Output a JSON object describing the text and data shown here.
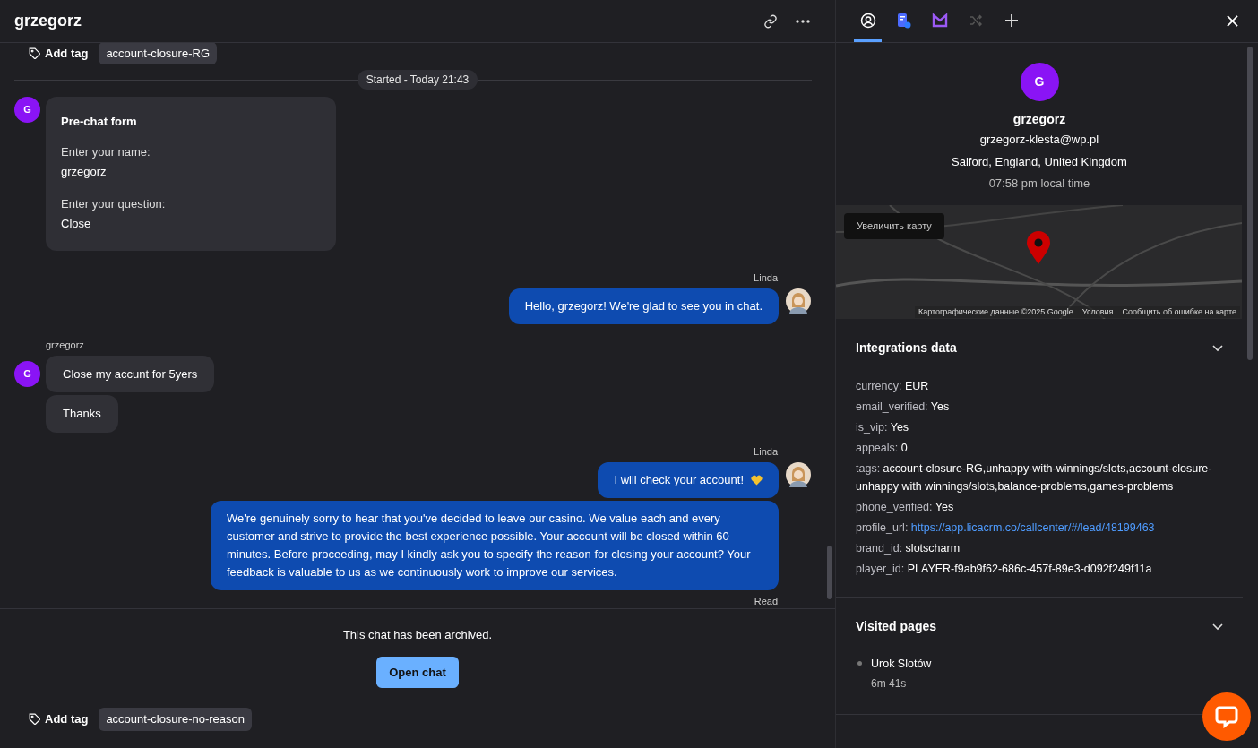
{
  "chat": {
    "title": "grzegorz",
    "top_tags": {
      "add_label": "Add tag",
      "tags": [
        "account-closure-RG"
      ]
    },
    "divider": "Started - Today 21:43",
    "messages": [
      {
        "kind": "form",
        "avatar": "G",
        "title": "Pre-chat form",
        "fields": [
          {
            "label": "Enter your name:",
            "value": "grzegorz"
          },
          {
            "label": "Enter your question:",
            "value": "Close"
          }
        ]
      },
      {
        "kind": "agent",
        "author": "Linda",
        "bubbles": [
          {
            "text": "Hello, grzegorz! We're glad to see you in chat.",
            "heart": false
          }
        ]
      },
      {
        "kind": "customer",
        "author": "grzegorz",
        "avatar": "G",
        "bubbles": [
          {
            "text": "Close my accunt for 5yers"
          },
          {
            "text": "Thanks"
          }
        ]
      },
      {
        "kind": "agent",
        "author": "Linda",
        "status": "Read",
        "bubbles": [
          {
            "text": "I will check your account!",
            "heart": true
          },
          {
            "text": "We're genuinely sorry to hear that you've decided to leave our casino. We value each and every customer and strive to provide the best experience possible. Your account will be closed within 60 minutes. Before proceeding, may I kindly ask you to specify the reason for closing your account? Your feedback is valuable to us as we continuously work to improve our services.",
            "heart": false
          }
        ]
      }
    ],
    "archived_note": "This chat has been archived.",
    "open_button": "Open chat",
    "bottom_tags": {
      "add_label": "Add tag",
      "tags": [
        "account-closure-no-reason"
      ]
    }
  },
  "details": {
    "tabs": [
      {
        "selected": true
      },
      {
        "selected": false
      },
      {
        "selected": false
      },
      {
        "selected": false
      },
      {
        "selected": false
      }
    ],
    "avatar": "G",
    "name": "grzegorz",
    "email": "grzegorz-klesta@wp.pl",
    "location": "Salford, England, United Kingdom",
    "local_time": "07:58 pm local time",
    "map": {
      "enlarge_button": "Увеличить карту",
      "attribution": "Картографические данные ©2025 Google",
      "terms": "Условия",
      "report": "Сообщить об ошибке на карте"
    },
    "sections": [
      {
        "kind": "fields",
        "title": "Integrations data",
        "expanded": true,
        "fields": [
          {
            "key": "currency:",
            "value": "EUR",
            "link": false
          },
          {
            "key": "email_verified:",
            "value": "Yes",
            "link": false
          },
          {
            "key": "is_vip:",
            "value": "Yes",
            "link": false
          },
          {
            "key": "appeals:",
            "value": "0",
            "link": false
          },
          {
            "key": "tags:",
            "value": "account-closure-RG,unhappy-with-winnings/slots,account-closure-unhappy with winnings/slots,balance-problems,games-problems",
            "link": false
          },
          {
            "key": "phone_verified:",
            "value": "Yes",
            "link": false
          },
          {
            "key": "profile_url:",
            "value": "https://app.licacrm.co/callcenter/#/lead/48199463",
            "link": true
          },
          {
            "key": "brand_id:",
            "value": "slotscharm",
            "link": false
          },
          {
            "key": "player_id:",
            "value": "PLAYER-f9ab9f62-686c-457f-89e3-d092f249f11a",
            "link": false
          }
        ]
      },
      {
        "kind": "pages",
        "title": "Visited pages",
        "expanded": true,
        "pages": [
          {
            "title": "Urok Slotów",
            "duration": "6m 41s"
          }
        ]
      }
    ]
  }
}
